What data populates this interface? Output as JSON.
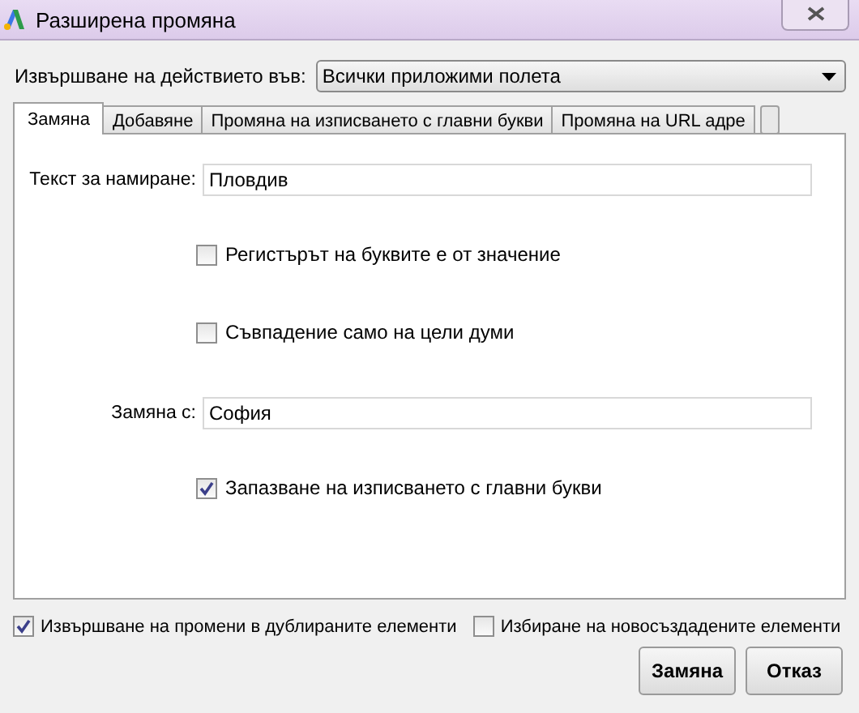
{
  "window": {
    "title": "Разширена промяна"
  },
  "scope": {
    "label": "Извършване на действието във:",
    "value": "Всички приложими полета"
  },
  "tabs": [
    {
      "label": "Замяна",
      "selected": true
    },
    {
      "label": "Добавяне",
      "selected": false
    },
    {
      "label": "Промяна на изписването с главни букви",
      "selected": false
    },
    {
      "label": "Промяна на URL адре",
      "selected": false
    }
  ],
  "panel": [
    {
      "kind": "field",
      "label": "Текст за намиране:",
      "value": "Пловдив"
    },
    {
      "kind": "checkbox",
      "label": "Регистърът на буквите е от значение",
      "checked": false
    },
    {
      "kind": "checkbox",
      "label": "Съвпадение само на цели думи",
      "checked": false
    },
    {
      "kind": "field",
      "label": "Замяна с:",
      "value": "София"
    },
    {
      "kind": "checkbox",
      "label": "Запазване на изписването с главни букви",
      "checked": true
    }
  ],
  "options": [
    {
      "label": "Извършване на промени в дублираните елементи",
      "checked": true
    },
    {
      "label": "Избиране на новосъздадените елементи",
      "checked": false
    }
  ],
  "buttons": [
    "Замяна",
    "Отказ"
  ]
}
